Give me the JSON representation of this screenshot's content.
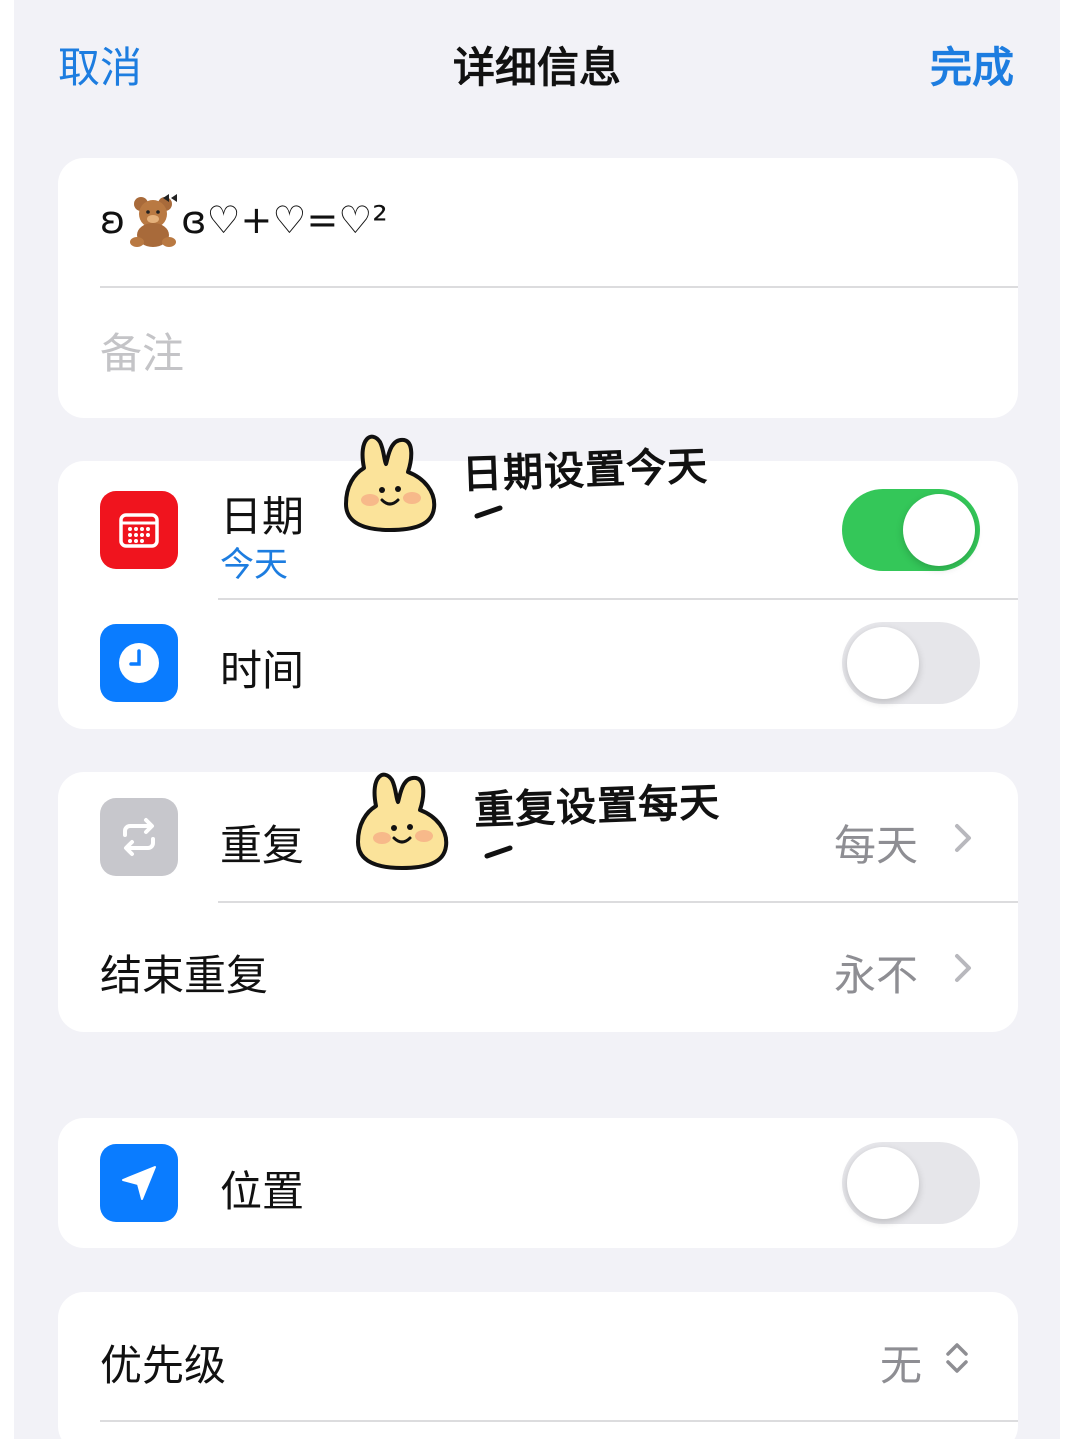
{
  "nav": {
    "cancel": "取消",
    "title": "详细信息",
    "done": "完成"
  },
  "reminder": {
    "title_text": "ʚ",
    "title_text_after": "ɞ♡+♡=♡²",
    "notes_placeholder": "备注"
  },
  "date_row": {
    "label": "日期",
    "sub": "今天",
    "toggle_on": true,
    "icon": "calendar-icon",
    "icon_color": "#f0141e"
  },
  "time_row": {
    "label": "时间",
    "toggle_on": false,
    "icon": "clock-icon",
    "icon_color": "#0a7cff"
  },
  "repeat_row": {
    "label": "重复",
    "value": "每天",
    "icon": "repeat-icon",
    "icon_color": "#c7c7cc"
  },
  "end_repeat_row": {
    "label": "结束重复",
    "value": "永不"
  },
  "location_row": {
    "label": "位置",
    "toggle_on": false,
    "icon": "location-arrow-icon",
    "icon_color": "#0a7cff"
  },
  "priority_row": {
    "label": "优先级",
    "value": "无"
  },
  "annotations": {
    "date_note": "日期设置今天",
    "repeat_note": "重复设置每天"
  },
  "colors": {
    "accent": "#1d7de0",
    "toggle_on": "#34c759",
    "background": "#f2f2f7"
  }
}
